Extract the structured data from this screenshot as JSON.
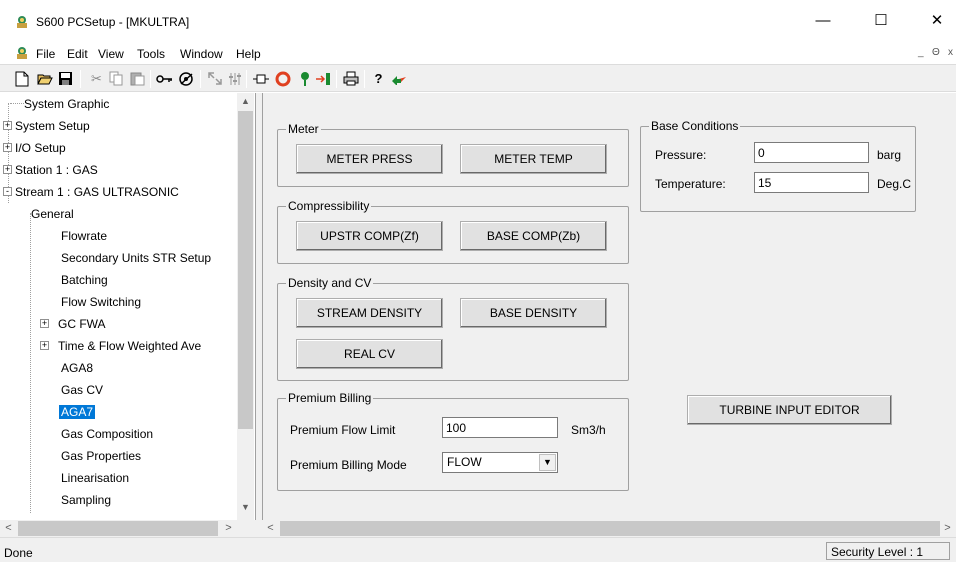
{
  "window": {
    "title": "S600 PCSetup  - [MKULTRA]",
    "minimize": "—",
    "maximize": "☐",
    "close": "✕"
  },
  "menubar": {
    "items": [
      "File",
      "Edit",
      "View",
      "Tools",
      "Window",
      "Help"
    ],
    "mdi_min": "_",
    "mdi_restore": "Θ",
    "mdi_close": "x"
  },
  "toolbar": {
    "icons": [
      "new-icon",
      "open-icon",
      "save-icon",
      "cut-icon",
      "copy-icon",
      "paste-icon",
      "key-icon",
      "connect-icon",
      "transfer-icon",
      "config-icon",
      "plug-icon",
      "stop-icon",
      "download-icon",
      "upload-icon",
      "print-icon",
      "help-icon",
      "context-help-icon"
    ]
  },
  "tree": {
    "items": [
      {
        "label": "System Graphic",
        "level": 0,
        "expander": ""
      },
      {
        "label": "System Setup",
        "level": 0,
        "expander": "+"
      },
      {
        "label": "I/O Setup",
        "level": 0,
        "expander": "+"
      },
      {
        "label": "Station 1 : GAS",
        "level": 0,
        "expander": "+"
      },
      {
        "label": "Stream 1 : GAS ULTRASONIC",
        "level": 0,
        "expander": "-"
      },
      {
        "label": "General",
        "level": 1,
        "expander": ""
      },
      {
        "label": "Flowrate",
        "level": 1,
        "expander": ""
      },
      {
        "label": "Secondary Units STR Setup",
        "level": 1,
        "expander": ""
      },
      {
        "label": "Batching",
        "level": 1,
        "expander": ""
      },
      {
        "label": "Flow Switching",
        "level": 1,
        "expander": ""
      },
      {
        "label": "GC FWA",
        "level": 1,
        "expander": "+"
      },
      {
        "label": "Time & Flow Weighted Ave",
        "level": 1,
        "expander": "+"
      },
      {
        "label": "AGA8",
        "level": 1,
        "expander": ""
      },
      {
        "label": "Gas CV",
        "level": 1,
        "expander": ""
      },
      {
        "label": "AGA7",
        "level": 1,
        "expander": "",
        "selected": true
      },
      {
        "label": "Gas Composition",
        "level": 1,
        "expander": ""
      },
      {
        "label": "Gas Properties",
        "level": 1,
        "expander": ""
      },
      {
        "label": "Linearisation",
        "level": 1,
        "expander": ""
      },
      {
        "label": "Sampling",
        "level": 1,
        "expander": ""
      }
    ]
  },
  "meter": {
    "legend": "Meter",
    "press_button": "METER PRESS",
    "temp_button": "METER TEMP"
  },
  "compressibility": {
    "legend": "Compressibility",
    "upstr_button": "UPSTR COMP(Zf)",
    "base_button": "BASE COMP(Zb)"
  },
  "density": {
    "legend": "Density and CV",
    "stream_button": "STREAM DENSITY",
    "base_button": "BASE DENSITY",
    "cv_button": "REAL CV"
  },
  "premium": {
    "legend": "Premium Billing",
    "flow_limit_label": "Premium Flow Limit",
    "flow_limit_value": "100",
    "flow_limit_unit": "Sm3/h",
    "mode_label": "Premium Billing Mode",
    "mode_value": "FLOW"
  },
  "base_conditions": {
    "legend": "Base Conditions",
    "pressure_label": "Pressure:",
    "pressure_value": "0",
    "pressure_unit": "barg",
    "temp_label": "Temperature:",
    "temp_value": "15",
    "temp_unit": "Deg.C"
  },
  "turbine_button": "TURBINE INPUT EDITOR",
  "statusbar": {
    "status": "Done",
    "security": "Security Level : 1"
  },
  "scroll": {
    "up": "▲",
    "down": "▼",
    "left": "<",
    "right": ">"
  }
}
